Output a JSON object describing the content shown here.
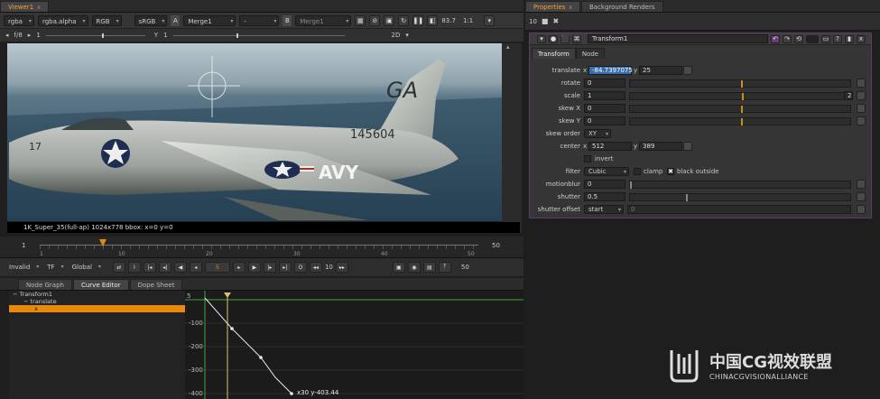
{
  "viewer": {
    "tab_label": "Viewer1",
    "tab_close": "x",
    "channels": "rgba",
    "alpha": "rgba.alpha",
    "colorspace": "RGB",
    "lut": "sRGB",
    "input_a_label": "A",
    "input_a": "Merge1",
    "wipe": "-",
    "input_b_label": "B",
    "input_b": "Merge1",
    "zoom": "83.7",
    "ratio": "1:1",
    "fstop": "f/8",
    "gain_label": "1",
    "y_label": "Y",
    "gamma": "1",
    "view_mode": "2D",
    "status": "1K_Super_35(full-ap) 1024x778  bbox: x=0 y=0",
    "plane_text_tail": "GA",
    "plane_text_body": "145604",
    "plane_text_nose": "17",
    "plane_text_side": "AVY"
  },
  "timeline": {
    "start": "1",
    "end": "50",
    "ticks": [
      "1",
      "10",
      "20",
      "30",
      "40",
      "50"
    ],
    "current_frame_position": 0.07,
    "in_frame": "1",
    "out_frame": "50"
  },
  "transport": {
    "range_mode": "Invalid",
    "tf_mode": "TF",
    "global_mode": "Global",
    "frame": "5",
    "step": "10",
    "end_frame": "50"
  },
  "bottom": {
    "tabs": [
      "Node Graph",
      "Curve Editor",
      "Dope Sheet"
    ],
    "tree": [
      "Transform1",
      "translate",
      "x"
    ],
    "curve_y_labels": [
      "-100",
      "-200",
      "-300",
      "-400"
    ],
    "curve_readout": "x30 y-403.44",
    "curve_top_label": "5"
  },
  "properties": {
    "tab_label": "Properties",
    "tab2_label": "Background Renders",
    "max_panels": "10",
    "node_name": "Transform1",
    "sub_tabs": [
      "Transform",
      "Node"
    ],
    "translate_label": "translate",
    "translate_x_label": "x",
    "translate_x": "-84.7397075",
    "translate_y_label": "y",
    "translate_y": "25",
    "rotate_label": "rotate",
    "rotate": "0",
    "scale_label": "scale",
    "scale": "1",
    "scale_btn": "2",
    "skew_x_label": "skew X",
    "skew_x": "0",
    "skew_y_label": "skew Y",
    "skew_y": "0",
    "skew_order_label": "skew order",
    "skew_order": "XY",
    "center_label": "center",
    "center_x_label": "x",
    "center_x": "512",
    "center_y_label": "y",
    "center_y": "389",
    "invert_label": "invert",
    "filter_label": "filter",
    "filter": "Cubic",
    "clamp_label": "clamp",
    "black_outside_label": "black outside",
    "black_outside_check": "✖",
    "motionblur_label": "motionblur",
    "motionblur": "0",
    "shutter_label": "shutter",
    "shutter": "0.5",
    "shutter_offset_label": "shutter offset",
    "shutter_offset": "start",
    "shutter_offset_value": "0"
  },
  "watermark": {
    "title": "中国CG视效联盟",
    "subtitle": "CHINACGVISIONALLIANCE"
  },
  "colors": {
    "accent": "#e8890e",
    "active_tab": "#f2a23a"
  }
}
